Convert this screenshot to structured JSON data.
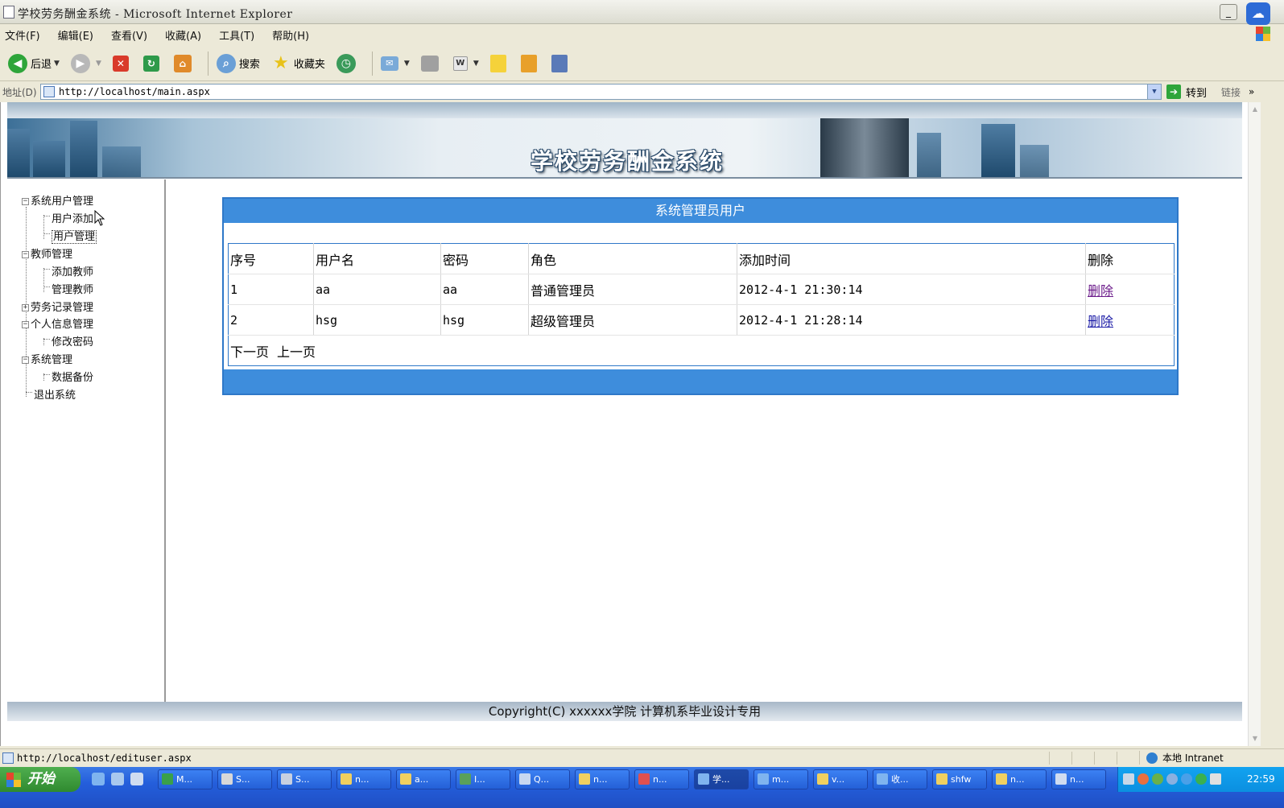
{
  "window": {
    "title": "学校劳务酬金系统 - Microsoft Internet Explorer",
    "minimize_label": "_"
  },
  "menu": [
    "文件(F)",
    "编辑(E)",
    "查看(V)",
    "收藏(A)",
    "工具(T)",
    "帮助(H)"
  ],
  "toolbar": {
    "back_label": "后退",
    "search_label": "搜索",
    "favorites_label": "收藏夹"
  },
  "address": {
    "label": "地址(D)",
    "url": "http://localhost/main.aspx",
    "go_label": "转到",
    "links_label": "链接"
  },
  "site": {
    "title": "学校劳务酬金系统",
    "footer": "Copyright(C) xxxxxx学院 计算机系毕业设计专用"
  },
  "tree": {
    "nodes": [
      {
        "label": "系统用户管理",
        "level": 0,
        "node": "−"
      },
      {
        "label": "用户添加",
        "level": 1
      },
      {
        "label": "用户管理",
        "level": 1
      },
      {
        "label": "教师管理",
        "level": 0,
        "node": "−"
      },
      {
        "label": "添加教师",
        "level": 1
      },
      {
        "label": "管理教师",
        "level": 1
      },
      {
        "label": "劳务记录管理",
        "level": 0,
        "node": "+"
      },
      {
        "label": "个人信息管理",
        "level": 0,
        "node": "−"
      },
      {
        "label": "修改密码",
        "level": 1
      },
      {
        "label": "系统管理",
        "level": 0,
        "node": "−"
      },
      {
        "label": "数据备份",
        "level": 1
      },
      {
        "label": "退出系统",
        "level": 0
      }
    ]
  },
  "panel": {
    "title": "系统管理员用户",
    "columns": [
      "序号",
      "用户名",
      "密码",
      "角色",
      "添加时间",
      "删除"
    ],
    "rows": [
      {
        "id": "1",
        "username": "aa",
        "password": "aa",
        "role": "普通管理员",
        "added": "2012-4-1 21:30:14",
        "action": "删除"
      },
      {
        "id": "2",
        "username": "hsg",
        "password": "hsg",
        "role": "超级管理员",
        "added": "2012-4-1 21:28:14",
        "action": "删除"
      }
    ],
    "pager": {
      "next": "下一页",
      "prev": "上一页"
    }
  },
  "status": {
    "url": "http://localhost/edituser.aspx",
    "zone": "本地 Intranet"
  },
  "taskbar": {
    "start_label": "开始",
    "tasks": [
      "M...",
      "S...",
      "S...",
      "n...",
      "a...",
      "I...",
      "Q...",
      "n...",
      "n...",
      "学...",
      "m...",
      "v...",
      "收...",
      "shfw",
      "n...",
      "n..."
    ],
    "clock": "22:59"
  },
  "colors": {
    "panel_blue": "#3e8ddc",
    "link_blue": "#1a1aa6",
    "link_visited": "#6b1a8a",
    "taskbar_blue": "#245edb"
  }
}
